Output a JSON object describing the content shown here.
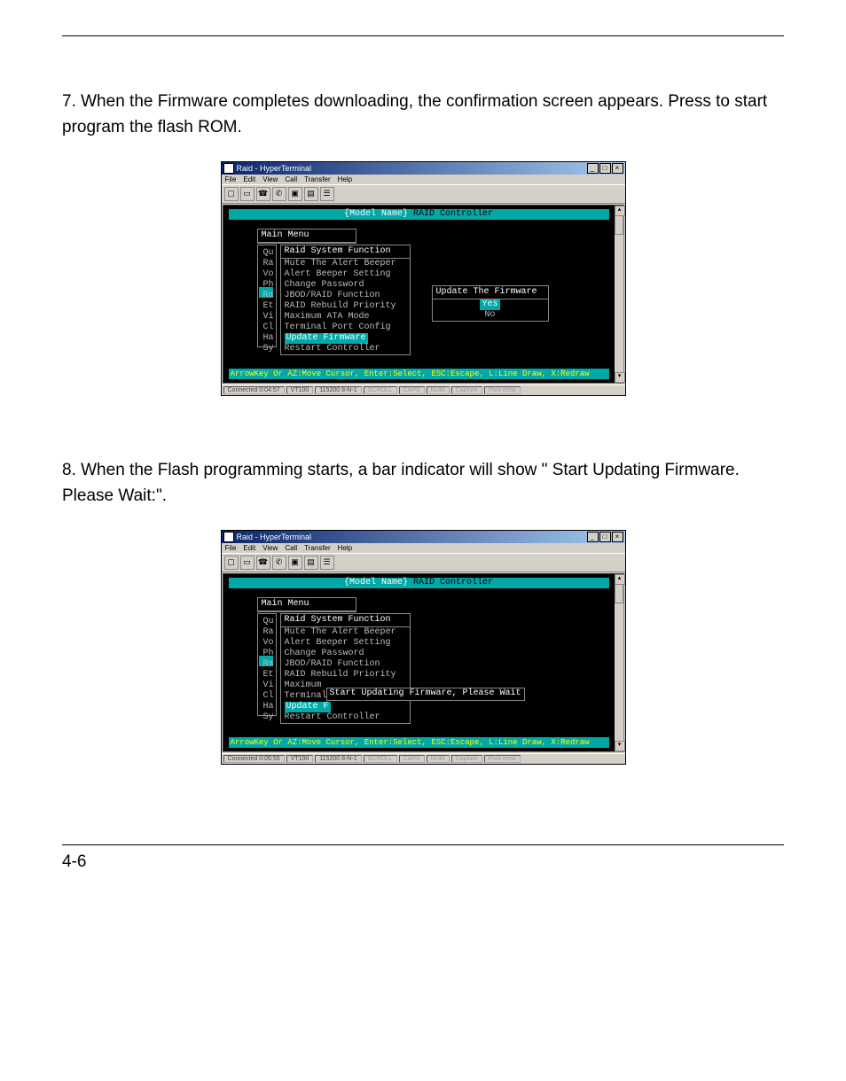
{
  "page": {
    "step7_text": "7. When the Firmware completes downloading, the confirmation screen appears. Press        to start program the flash ROM.",
    "step8_text": "8. When the Flash programming starts, a bar indicator will show \" Start Updating Firmware. Please Wait:\".",
    "page_number": "4-6"
  },
  "ht": {
    "title": "Raid - HyperTerminal",
    "menus": [
      "File",
      "Edit",
      "View",
      "Call",
      "Transfer",
      "Help"
    ],
    "win_btns": [
      "_",
      "□",
      "×"
    ],
    "status": {
      "connected1": "Connected 0:04:57",
      "connected2": "Connected 0:05:55",
      "emu": "VT100",
      "baud": "115200 8-N-1",
      "scroll": "SCROLL",
      "caps": "CAPS",
      "num": "NUM",
      "capture": "Capture",
      "printecho": "Print echo"
    }
  },
  "term": {
    "title_left": "{Model Name}",
    "title_right": " RAID Controller",
    "main_menu": "Main Menu",
    "side_items": [
      "Qu",
      "Ra",
      "Vo",
      "Ph",
      "Ra",
      "Et",
      "Vi",
      "Cl",
      "Ha",
      "Sy"
    ],
    "rsf_title": "Raid System Function",
    "rsf_items": [
      "Mute The Alert Beeper",
      "Alert Beeper Setting",
      "Change Password",
      "JBOD/RAID Function",
      "RAID Rebuild Priority",
      "Maximum ATA Mode",
      "Terminal Port Config",
      "Update FirmWare",
      "Restart Controller"
    ],
    "confirm_title": "Update The Firmware",
    "confirm_items": [
      "Yes",
      "No"
    ],
    "progress_msg": "Start Updating Firmware, Please Wait",
    "rsf_items_short": [
      "Mute The Alert Beeper",
      "Alert Beeper Setting",
      "Change Password",
      "JBOD/RAID Function",
      "RAID Rebuild Priority",
      "Maximum",
      "Terminal",
      "Update F",
      "Restart Controller"
    ],
    "helpbar": "ArrowKey Or AZ:Move Cursor, Enter:Select, ESC:Escape, L:Line Draw, X:Redraw"
  }
}
